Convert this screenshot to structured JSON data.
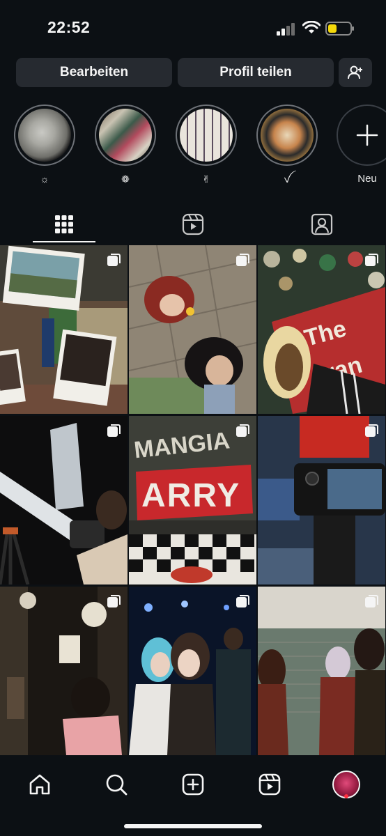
{
  "status_bar": {
    "time": "22:52",
    "battery_color": "#f5d90a"
  },
  "profile_actions": {
    "edit_label": "Bearbeiten",
    "share_label": "Profil teilen",
    "add_person_icon": "add-person-icon"
  },
  "highlights": [
    {
      "label": "☼",
      "icon": "moon-image"
    },
    {
      "label": "❁",
      "icon": "graffiti-image"
    },
    {
      "label": "✌",
      "icon": "photo-wall-image"
    },
    {
      "label": "ꪜ",
      "icon": "mural-face-image"
    },
    {
      "label": "Neu",
      "icon": "plus-icon"
    }
  ],
  "tabs": [
    {
      "name": "grid",
      "icon": "grid-icon",
      "active": true
    },
    {
      "name": "reels",
      "icon": "reels-icon",
      "active": false
    },
    {
      "name": "tagged",
      "icon": "tagged-icon",
      "active": false
    }
  ],
  "posts": [
    {
      "subject": "polaroid-collage",
      "multi": true
    },
    {
      "subject": "top-down-selfie",
      "multi": true
    },
    {
      "subject": "sticker-wall",
      "multi": true
    },
    {
      "subject": "telescope-night",
      "multi": true
    },
    {
      "subject": "graffiti-wall",
      "multi": true
    },
    {
      "subject": "camera-screen",
      "multi": true
    },
    {
      "subject": "dark-bar-interior",
      "multi": true
    },
    {
      "subject": "friends-concert",
      "multi": true
    },
    {
      "subject": "tunnel-portrait",
      "multi": true
    }
  ],
  "bottom_nav": [
    "home-icon",
    "search-icon",
    "create-icon",
    "reels-icon",
    "profile-avatar"
  ],
  "colors": {
    "background": "#0c1014",
    "button": "#262a30",
    "notification_dot": "#ff3040"
  }
}
